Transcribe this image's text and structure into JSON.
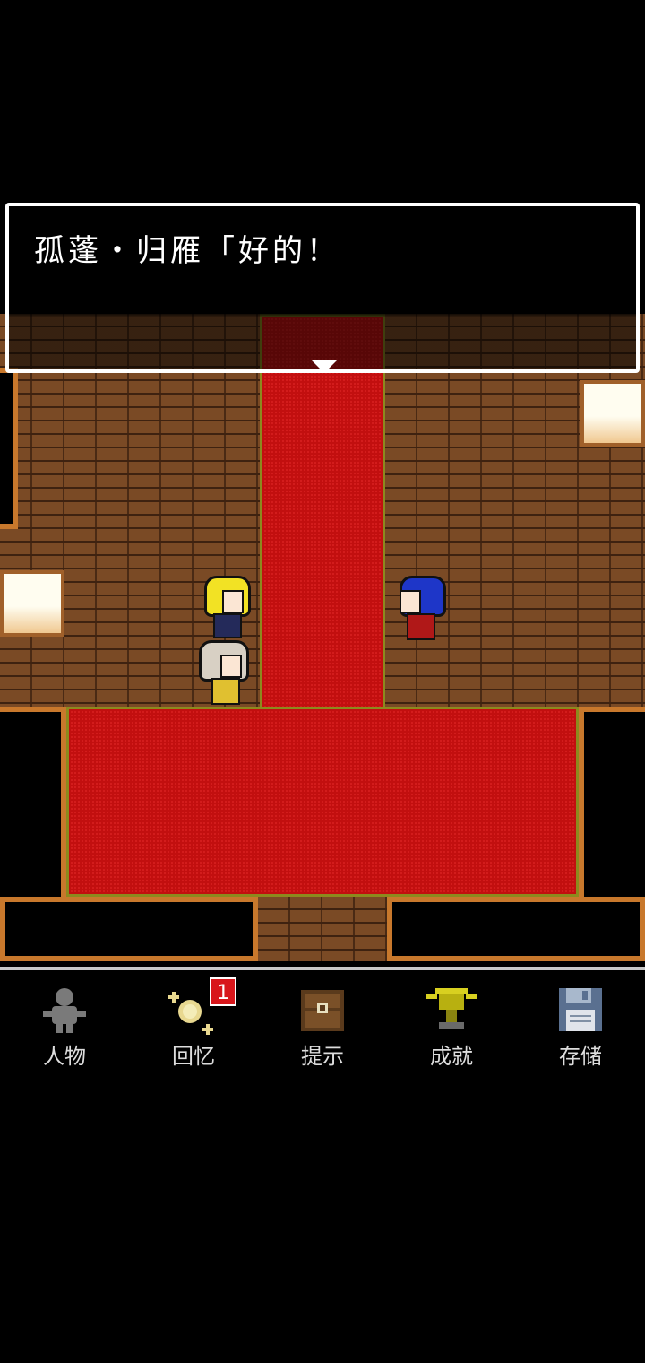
{
  "dialog": {
    "text": "孤蓬・归雁「好的！"
  },
  "menu": {
    "items": [
      {
        "label": "人物",
        "icon": "person-icon"
      },
      {
        "label": "回忆",
        "icon": "memory-sparkle-icon"
      },
      {
        "label": "提示",
        "icon": "hint-chest-icon"
      },
      {
        "label": "成就",
        "icon": "trophy-icon"
      },
      {
        "label": "存储",
        "icon": "save-disk-icon"
      }
    ],
    "memory_badge": "1"
  },
  "colors": {
    "carpet": "#c20f0f",
    "wood": "#7a4a25",
    "frame": "#c8782c",
    "badge": "#d8161b"
  }
}
